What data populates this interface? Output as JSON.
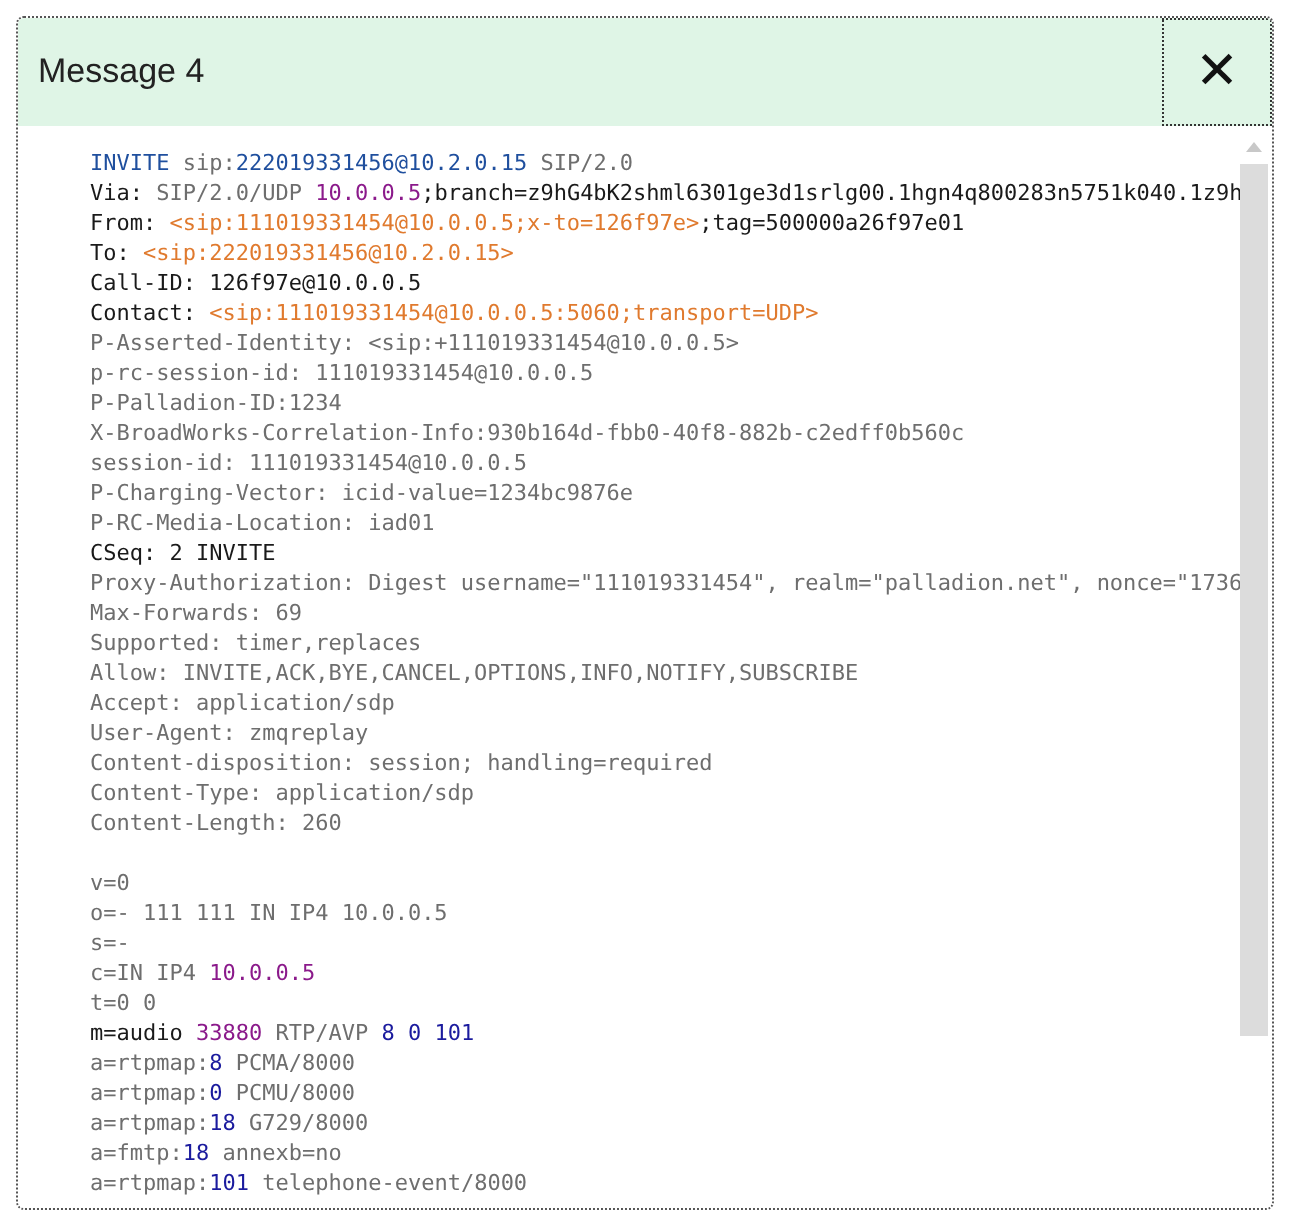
{
  "dialog": {
    "title": "Message 4",
    "close_label": "✕"
  },
  "message": {
    "lines": [
      {
        "kind": "text",
        "parts": [
          {
            "kind": "method",
            "text": "INVITE"
          },
          {
            "kind": "dim",
            "text": " sip:"
          },
          {
            "kind": "method",
            "text": "222019331456@10.2.0.15"
          },
          {
            "kind": "dim",
            "text": " SIP/2.0"
          }
        ]
      },
      {
        "kind": "text",
        "parts": [
          {
            "kind": "key",
            "text": "Via: "
          },
          {
            "kind": "dim",
            "text": "SIP/2.0/UDP "
          },
          {
            "kind": "addr",
            "text": "10.0.0.5"
          },
          {
            "kind": "key",
            "text": ";branch=z9hG4bK2shml6301ge3d1srlg00.1hgn4q800283n5751k040.1z9h"
          }
        ]
      },
      {
        "kind": "text",
        "parts": [
          {
            "kind": "key",
            "text": "From: "
          },
          {
            "kind": "uri",
            "text": "<sip:111019331454@10.0.0.5;x-to=126f97e>"
          },
          {
            "kind": "key",
            "text": ";tag=500000a26f97e01"
          }
        ]
      },
      {
        "kind": "text",
        "parts": [
          {
            "kind": "key",
            "text": "To: "
          },
          {
            "kind": "uri",
            "text": "<sip:222019331456@10.2.0.15>"
          }
        ]
      },
      {
        "kind": "text",
        "parts": [
          {
            "kind": "key",
            "text": "Call-ID: 126f97e@10.0.0.5"
          }
        ]
      },
      {
        "kind": "text",
        "parts": [
          {
            "kind": "key",
            "text": "Contact: "
          },
          {
            "kind": "uri",
            "text": "<sip:111019331454@10.0.0.5:5060;transport=UDP>"
          }
        ]
      },
      {
        "kind": "text",
        "parts": [
          {
            "kind": "dim",
            "text": "P-Asserted-Identity: <sip:+111019331454@10.0.0.5>"
          }
        ]
      },
      {
        "kind": "text",
        "parts": [
          {
            "kind": "dim",
            "text": "p-rc-session-id: 111019331454@10.0.0.5"
          }
        ]
      },
      {
        "kind": "text",
        "parts": [
          {
            "kind": "dim",
            "text": "P-Palladion-ID:1234"
          }
        ]
      },
      {
        "kind": "text",
        "parts": [
          {
            "kind": "dim",
            "text": "X-BroadWorks-Correlation-Info:930b164d-fbb0-40f8-882b-c2edff0b560c"
          }
        ]
      },
      {
        "kind": "text",
        "parts": [
          {
            "kind": "dim",
            "text": "session-id: 111019331454@10.0.0.5"
          }
        ]
      },
      {
        "kind": "text",
        "parts": [
          {
            "kind": "dim",
            "text": "P-Charging-Vector: icid-value=1234bc9876e"
          }
        ]
      },
      {
        "kind": "text",
        "parts": [
          {
            "kind": "dim",
            "text": "P-RC-Media-Location: iad01"
          }
        ]
      },
      {
        "kind": "text",
        "parts": [
          {
            "kind": "key",
            "text": "CSeq: 2 INVITE"
          }
        ]
      },
      {
        "kind": "text",
        "parts": [
          {
            "kind": "dim",
            "text": "Proxy-Authorization: Digest username=\"111019331454\", realm=\"palladion.net\", nonce=\"1736"
          }
        ]
      },
      {
        "kind": "text",
        "parts": [
          {
            "kind": "dim",
            "text": "Max-Forwards: 69"
          }
        ]
      },
      {
        "kind": "text",
        "parts": [
          {
            "kind": "dim",
            "text": "Supported: timer,replaces"
          }
        ]
      },
      {
        "kind": "text",
        "parts": [
          {
            "kind": "dim",
            "text": "Allow: INVITE,ACK,BYE,CANCEL,OPTIONS,INFO,NOTIFY,SUBSCRIBE"
          }
        ]
      },
      {
        "kind": "text",
        "parts": [
          {
            "kind": "dim",
            "text": "Accept: application/sdp"
          }
        ]
      },
      {
        "kind": "text",
        "parts": [
          {
            "kind": "dim",
            "text": "User-Agent: zmqreplay"
          }
        ]
      },
      {
        "kind": "text",
        "parts": [
          {
            "kind": "dim",
            "text": "Content-disposition: session; handling=required"
          }
        ]
      },
      {
        "kind": "text",
        "parts": [
          {
            "kind": "dim",
            "text": "Content-Type: application/sdp"
          }
        ]
      },
      {
        "kind": "text",
        "parts": [
          {
            "kind": "dim",
            "text": "Content-Length: 260"
          }
        ]
      },
      {
        "kind": "blank"
      },
      {
        "kind": "text",
        "parts": [
          {
            "kind": "dim",
            "text": "v=0"
          }
        ]
      },
      {
        "kind": "text",
        "parts": [
          {
            "kind": "dim",
            "text": "o=- 111 111 IN IP4 10.0.0.5"
          }
        ]
      },
      {
        "kind": "text",
        "parts": [
          {
            "kind": "dim",
            "text": "s=-"
          }
        ]
      },
      {
        "kind": "text",
        "parts": [
          {
            "kind": "dim",
            "text": "c=IN IP4 "
          },
          {
            "kind": "addr",
            "text": "10.0.0.5"
          }
        ]
      },
      {
        "kind": "text",
        "parts": [
          {
            "kind": "dim",
            "text": "t=0 0"
          }
        ]
      },
      {
        "kind": "text",
        "parts": [
          {
            "kind": "key",
            "text": "m=audio "
          },
          {
            "kind": "addr",
            "text": "33880"
          },
          {
            "kind": "dim",
            "text": " RTP/AVP "
          },
          {
            "kind": "num",
            "text": "8 0 101"
          }
        ]
      },
      {
        "kind": "text",
        "parts": [
          {
            "kind": "dim",
            "text": "a=rtpmap:"
          },
          {
            "kind": "num",
            "text": "8"
          },
          {
            "kind": "dim",
            "text": " PCMA/8000"
          }
        ]
      },
      {
        "kind": "text",
        "parts": [
          {
            "kind": "dim",
            "text": "a=rtpmap:"
          },
          {
            "kind": "num",
            "text": "0"
          },
          {
            "kind": "dim",
            "text": " PCMU/8000"
          }
        ]
      },
      {
        "kind": "text",
        "parts": [
          {
            "kind": "dim",
            "text": "a=rtpmap:"
          },
          {
            "kind": "num",
            "text": "18"
          },
          {
            "kind": "dim",
            "text": " G729/8000"
          }
        ]
      },
      {
        "kind": "text",
        "parts": [
          {
            "kind": "dim",
            "text": "a=fmtp:"
          },
          {
            "kind": "num",
            "text": "18"
          },
          {
            "kind": "dim",
            "text": " annexb=no"
          }
        ]
      },
      {
        "kind": "text",
        "parts": [
          {
            "kind": "dim",
            "text": "a=rtpmap:"
          },
          {
            "kind": "num",
            "text": "101"
          },
          {
            "kind": "dim",
            "text": " telephone-event/8000"
          }
        ]
      }
    ]
  }
}
